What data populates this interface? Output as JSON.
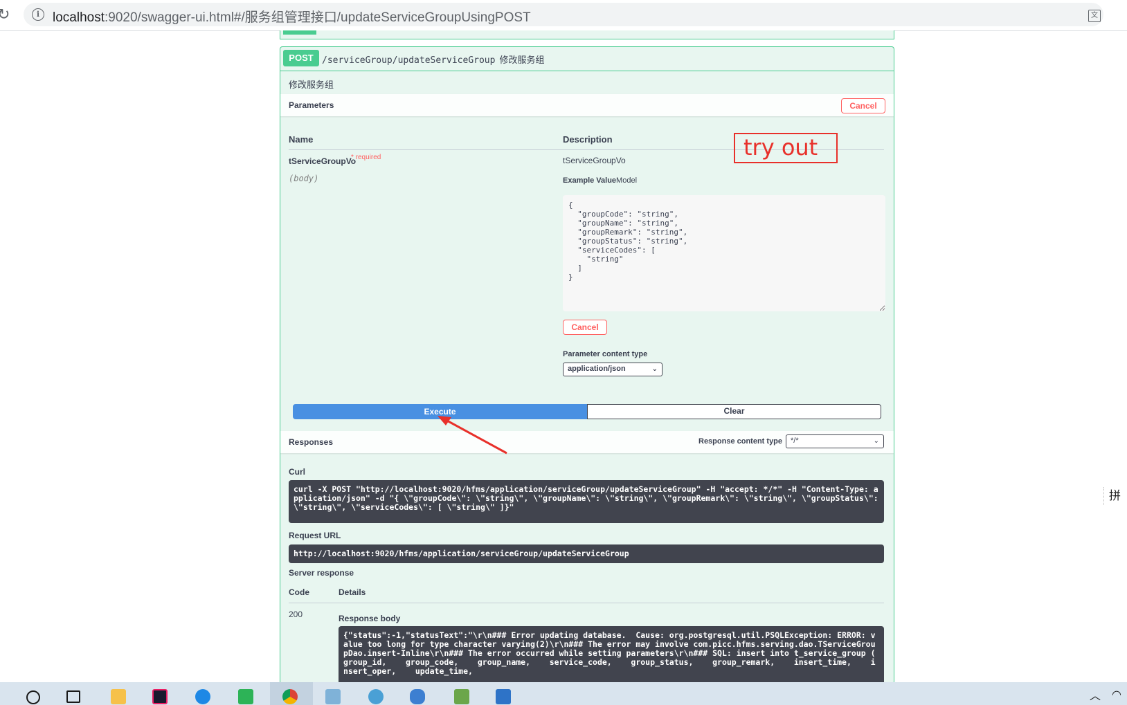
{
  "browser": {
    "url_host": "localhost",
    "url_rest": ":9020/swagger-ui.html#/服务组管理接口/updateServiceGroupUsingPOST"
  },
  "operation": {
    "method": "POST",
    "path": "/serviceGroup/updateServiceGroup",
    "summary": "修改服务组",
    "description": "修改服务组"
  },
  "parameters": {
    "title": "Parameters",
    "cancel_label": "Cancel",
    "col_name": "Name",
    "col_description": "Description",
    "param_name": "tServiceGroupVo",
    "param_required": "* required",
    "param_in": "(body)",
    "param_type": "tServiceGroupVo",
    "example_value": "Example Value",
    "model": "Model",
    "body_value": "{\n  \"groupCode\": \"string\",\n  \"groupName\": \"string\",\n  \"groupRemark\": \"string\",\n  \"groupStatus\": \"string\",\n  \"serviceCodes\": [\n    \"string\"\n  ]\n}",
    "body_cancel_label": "Cancel",
    "content_type_label": "Parameter content type",
    "content_type_value": "application/json"
  },
  "actions": {
    "execute_label": "Execute",
    "clear_label": "Clear"
  },
  "responses": {
    "title": "Responses",
    "content_type_label": "Response content type",
    "content_type_value": "*/*",
    "curl_label": "Curl",
    "curl": "curl -X POST \"http://localhost:9020/hfms/application/serviceGroup/updateServiceGroup\" -H \"accept: */*\" -H \"Content-Type: application/json\" -d \"{ \\\"groupCode\\\": \\\"string\\\", \\\"groupName\\\": \\\"string\\\", \\\"groupRemark\\\": \\\"string\\\", \\\"groupStatus\\\": \\\"string\\\", \\\"serviceCodes\\\": [ \\\"string\\\" ]}\"",
    "request_url_label": "Request URL",
    "request_url": "http://localhost:9020/hfms/application/serviceGroup/updateServiceGroup",
    "server_response_label": "Server response",
    "col_code": "Code",
    "col_details": "Details",
    "code": "200",
    "response_body_label": "Response body",
    "response_body": "{\"status\":-1,\"statusText\":\"\\r\\n### Error updating database.  Cause: org.postgresql.util.PSQLException: ERROR: value too long for type character varying(2)\\r\\n### The error may involve com.picc.hfms.serving.dao.TServiceGroupDao.insert-Inline\\r\\n### The error occurred while setting parameters\\r\\n### SQL: insert into t_service_group (    group_id,    group_code,    group_name,    service_code,    group_status,    group_remark,    insert_time,    insert_oper,    update_time,"
  },
  "annotation": {
    "text": "try out",
    "color": "#e8302a"
  },
  "ime": {
    "label": "拼"
  },
  "colors": {
    "post_green": "#49cc90",
    "post_bg": "#e8f6f0",
    "execute_blue": "#4990e2",
    "cancel_red": "#ff6060",
    "code_bg": "#41444e"
  }
}
